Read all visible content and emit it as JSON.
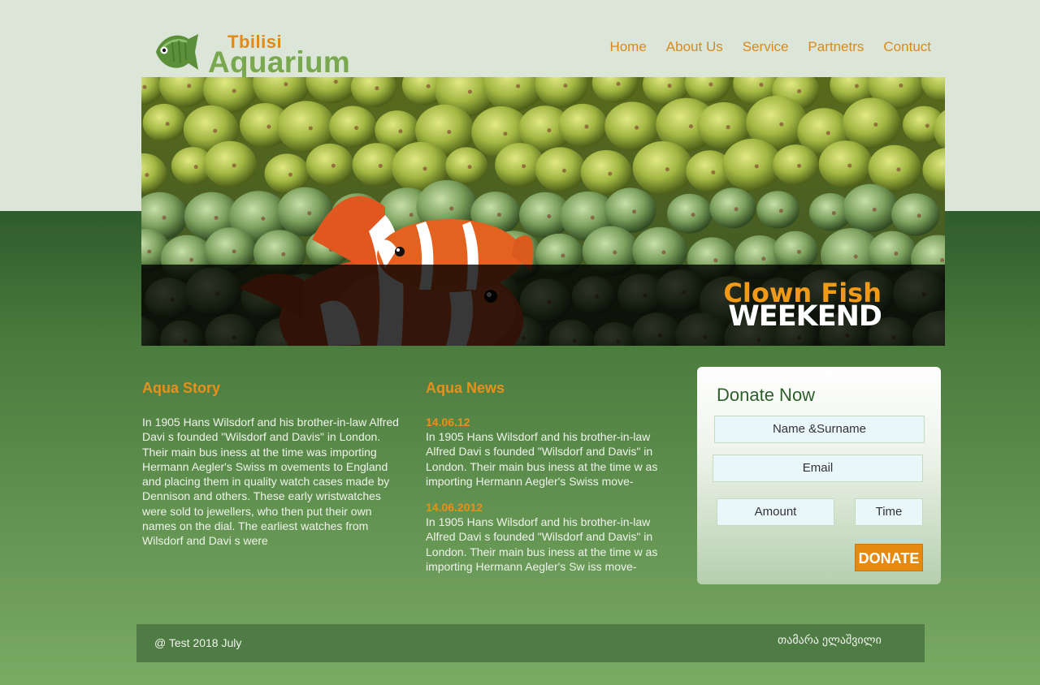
{
  "header": {
    "logo_top": "Tbilisi",
    "logo_bottom": "Aquarium",
    "nav": [
      "Home",
      "About Us",
      "Service",
      "Partnetrs",
      "Contuct"
    ]
  },
  "hero": {
    "line1": "Clown Fish",
    "line2": "WEEKEND"
  },
  "story": {
    "title": "Aqua Story",
    "text": "In 1905 Hans Wilsdorf and his brother-in-law Alfred Davi s founded \"Wilsdorf and Davis\" in London. Their main bus iness at the time was importing Hermann Aegler's Swiss m ovements to England and placing them in quality watch cases made by Dennison and others. These early wristwatches were sold to jewellers, who then put their own names on the dial. The earliest watches from Wilsdorf and Davi s were"
  },
  "news": {
    "title": "Aqua News",
    "items": [
      {
        "date": "14.06.12",
        "text": "In 1905 Hans Wilsdorf and his brother-in-law Alfred Davi s founded \"Wilsdorf and Davis\" in London. Their main bus iness at the time w as importing Hermann Aegler's Swiss move-"
      },
      {
        "date": "14.06.2012",
        "text": "In 1905 Hans Wilsdorf and his brother-in-law Alfred Davi s founded \"Wilsdorf and Davis\" in London. Their main bus iness at the time w as importing Hermann Aegler's Sw iss move-"
      }
    ]
  },
  "donate": {
    "title": "Donate Now",
    "name_placeholder": "Name &Surname",
    "email_placeholder": "Email",
    "amount_placeholder": "Amount",
    "time_placeholder": "Time",
    "button": "DONATE"
  },
  "footer": {
    "left": "@ Test 2018 July",
    "right": "თამარა ელაშვილი"
  },
  "colors": {
    "accent": "#e08a18",
    "dark_green": "#2f5c2c",
    "logo_green": "#7aa84f"
  }
}
